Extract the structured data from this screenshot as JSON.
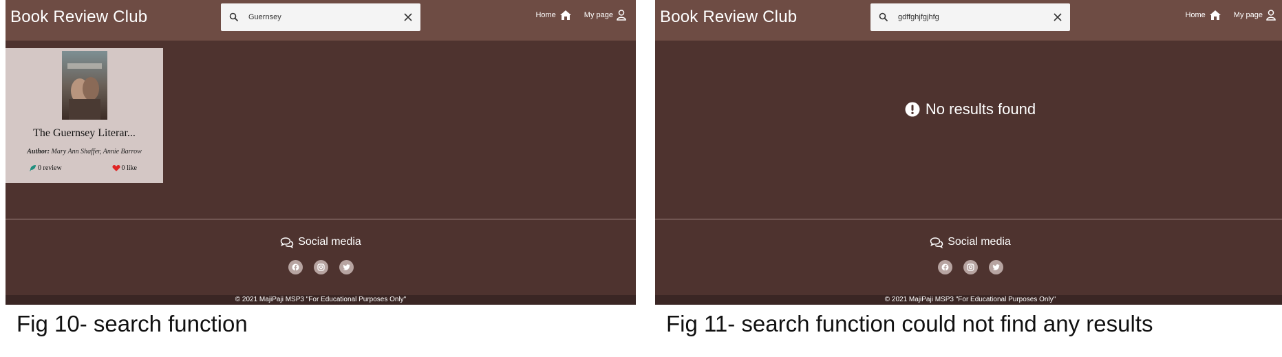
{
  "colors": {
    "header_bg": "#6e4c44",
    "page_bg": "#4e332f",
    "card_bg": "#d4c7c5",
    "footer_bg": "#3a2624",
    "social_icon_bg": "#b7a4a1",
    "heart": "#e02424",
    "review_icon": "#1f8f7f"
  },
  "fig10": {
    "header": {
      "brand": "Book Review Club",
      "search": {
        "value": "Guernsey",
        "search_icon": "search-icon",
        "clear_icon": "close-icon"
      },
      "nav": {
        "home": "Home",
        "home_icon": "home-icon",
        "mypage": "My page",
        "mypage_icon": "user-icon"
      }
    },
    "result": {
      "title": "The Guernsey Literar...",
      "author_label": "Author:",
      "author": "Mary Ann Shaffer, Annie Barrow",
      "reviews": "0 review",
      "review_icon": "feather-icon",
      "likes": "0 like",
      "like_icon": "heart-icon"
    },
    "footer": {
      "social_title": "Social media",
      "social_icon": "comments-icon",
      "icons": [
        "facebook-icon",
        "instagram-icon",
        "twitter-icon"
      ],
      "copyright": "© 2021 MajiPaji MSP3 \"For Educational Purposes Only\""
    },
    "caption": "Fig 10- search function"
  },
  "fig11": {
    "header": {
      "brand": "Book Review Club",
      "search": {
        "value": "gdffghjfgjhfg",
        "search_icon": "search-icon",
        "clear_icon": "close-icon"
      },
      "nav": {
        "home": "Home",
        "home_icon": "home-icon",
        "mypage": "My page",
        "mypage_icon": "user-icon"
      }
    },
    "message": "No results found",
    "message_icon": "exclamation-circle-icon",
    "footer": {
      "social_title": "Social media",
      "social_icon": "comments-icon",
      "icons": [
        "facebook-icon",
        "instagram-icon",
        "twitter-icon"
      ],
      "copyright": "© 2021 MajiPaji MSP3 \"For Educational Purposes Only\""
    },
    "caption": "Fig 11- search function could not find any results"
  }
}
